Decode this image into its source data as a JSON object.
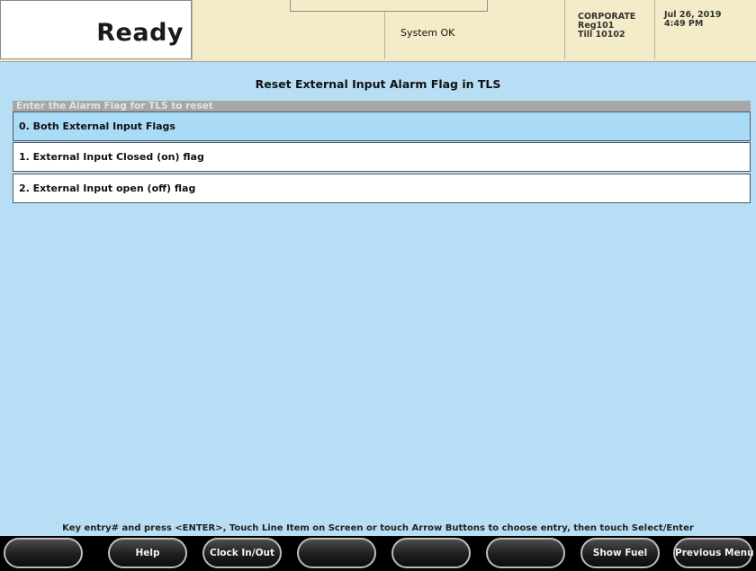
{
  "header": {
    "status_word": "Ready",
    "system_status": "System OK",
    "site": [
      "CORPORATE",
      "Reg101",
      "Till 10102"
    ],
    "datetime": [
      "Jul 26, 2019",
      "4:49 PM"
    ]
  },
  "screen": {
    "title": "Reset External Input Alarm Flag in TLS",
    "prompt": "Enter the Alarm Flag for TLS to reset",
    "options": [
      {
        "label": "0. Both External Input Flags",
        "selected": true
      },
      {
        "label": "1. External Input Closed (on) flag",
        "selected": false
      },
      {
        "label": "2. External Input open (off) flag",
        "selected": false
      }
    ],
    "instruction": "Key entry# and press <ENTER>, Touch Line Item on Screen or touch Arrow Buttons to choose entry, then touch Select/Enter"
  },
  "softkeys": [
    "",
    "Help",
    "Clock In/Out",
    "",
    "",
    "",
    "Show Fuel",
    "Previous Menu"
  ],
  "colors": {
    "background": "#b8def5",
    "header": "#f4ecc9",
    "selected_row": "#a9dbf7",
    "prompt_bar": "#a7a7a7"
  }
}
